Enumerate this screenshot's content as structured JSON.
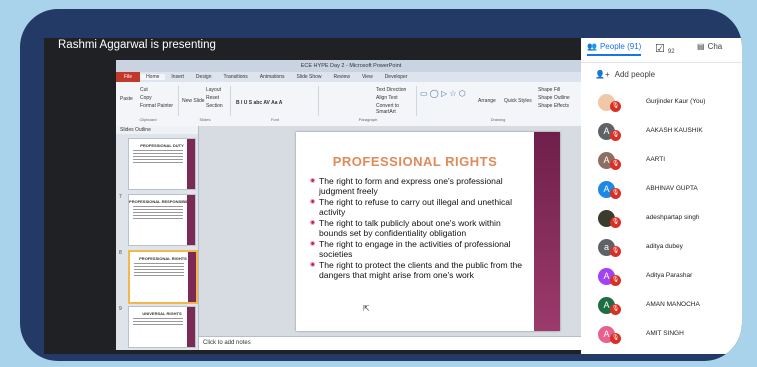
{
  "presenter": "Rashmi Aggarwal is presenting",
  "ppt": {
    "window_title": "ECE HYPE Day 2 - Microsoft PowerPoint",
    "menu": [
      "File",
      "Home",
      "Insert",
      "Design",
      "Transitions",
      "Animations",
      "Slide Show",
      "Review",
      "View",
      "Developer"
    ],
    "ribbon": {
      "cut": "Cut",
      "copy": "Copy",
      "paste": "Paste",
      "format_painter": "Format Painter",
      "new_slide": "New Slide",
      "layout": "Layout",
      "reset": "Reset",
      "section": "Section",
      "clipboard": "Clipboard",
      "slides": "Slides",
      "font": "Font",
      "paragraph": "Paragraph",
      "drawing": "Drawing",
      "text_direction": "Text Direction",
      "align_text": "Align Text",
      "convert_smartart": "Convert to SmartArt",
      "arrange": "Arrange",
      "quick_styles": "Quick Styles",
      "shape_fill": "Shape Fill",
      "shape_outline": "Shape Outline",
      "shape_effects": "Shape Effects"
    },
    "pane_tabs": "Slides  Outline",
    "thumbs": [
      {
        "num": "",
        "title": "PROFESSIONAL DUTY"
      },
      {
        "num": "7",
        "title": "PROFESSIONAL RESPONSIBILITY"
      },
      {
        "num": "8",
        "title": "PROFESSIONAL RIGHTS"
      },
      {
        "num": "9",
        "title": "UNIVERSAL RIGHTS"
      }
    ],
    "notes": "Click to add notes",
    "slide": {
      "title": "PROFESSIONAL RIGHTS",
      "bullets": [
        "The right to form and express one's professional judgment freely",
        "The right to refuse to carry out illegal and unethical activity",
        "The right to talk publicly about one's work within bounds set by confidentiality obligation",
        "The right to engage in the activities of professional societies",
        "The right to protect the clients and the public from the dangers that might arise from one's work"
      ]
    }
  },
  "panel": {
    "people_tab": "People (91)",
    "tasks_tab": "92",
    "chat_tab": "Cha",
    "add_people": "Add people",
    "participants": [
      {
        "name": "Gurjinder Kaur (You)",
        "initial": "",
        "color": "#f0c8a8"
      },
      {
        "name": "AAKASH KAUSHIK",
        "initial": "A",
        "color": "#5f6368"
      },
      {
        "name": "AARTI",
        "initial": "A",
        "color": "#8d6e63"
      },
      {
        "name": "ABHINAV GUPTA",
        "initial": "A",
        "color": "#1e88e5"
      },
      {
        "name": "adeshpartap singh",
        "initial": "",
        "color": "#3b3b2e"
      },
      {
        "name": "aditya dubey",
        "initial": "a",
        "color": "#5f6368"
      },
      {
        "name": "Aditya Parashar",
        "initial": "A",
        "color": "#a142f4"
      },
      {
        "name": "AMAN MANOCHA",
        "initial": "A",
        "color": "#1e6e43"
      },
      {
        "name": "AMIT SINGH",
        "initial": "A",
        "color": "#e8618c"
      }
    ]
  }
}
